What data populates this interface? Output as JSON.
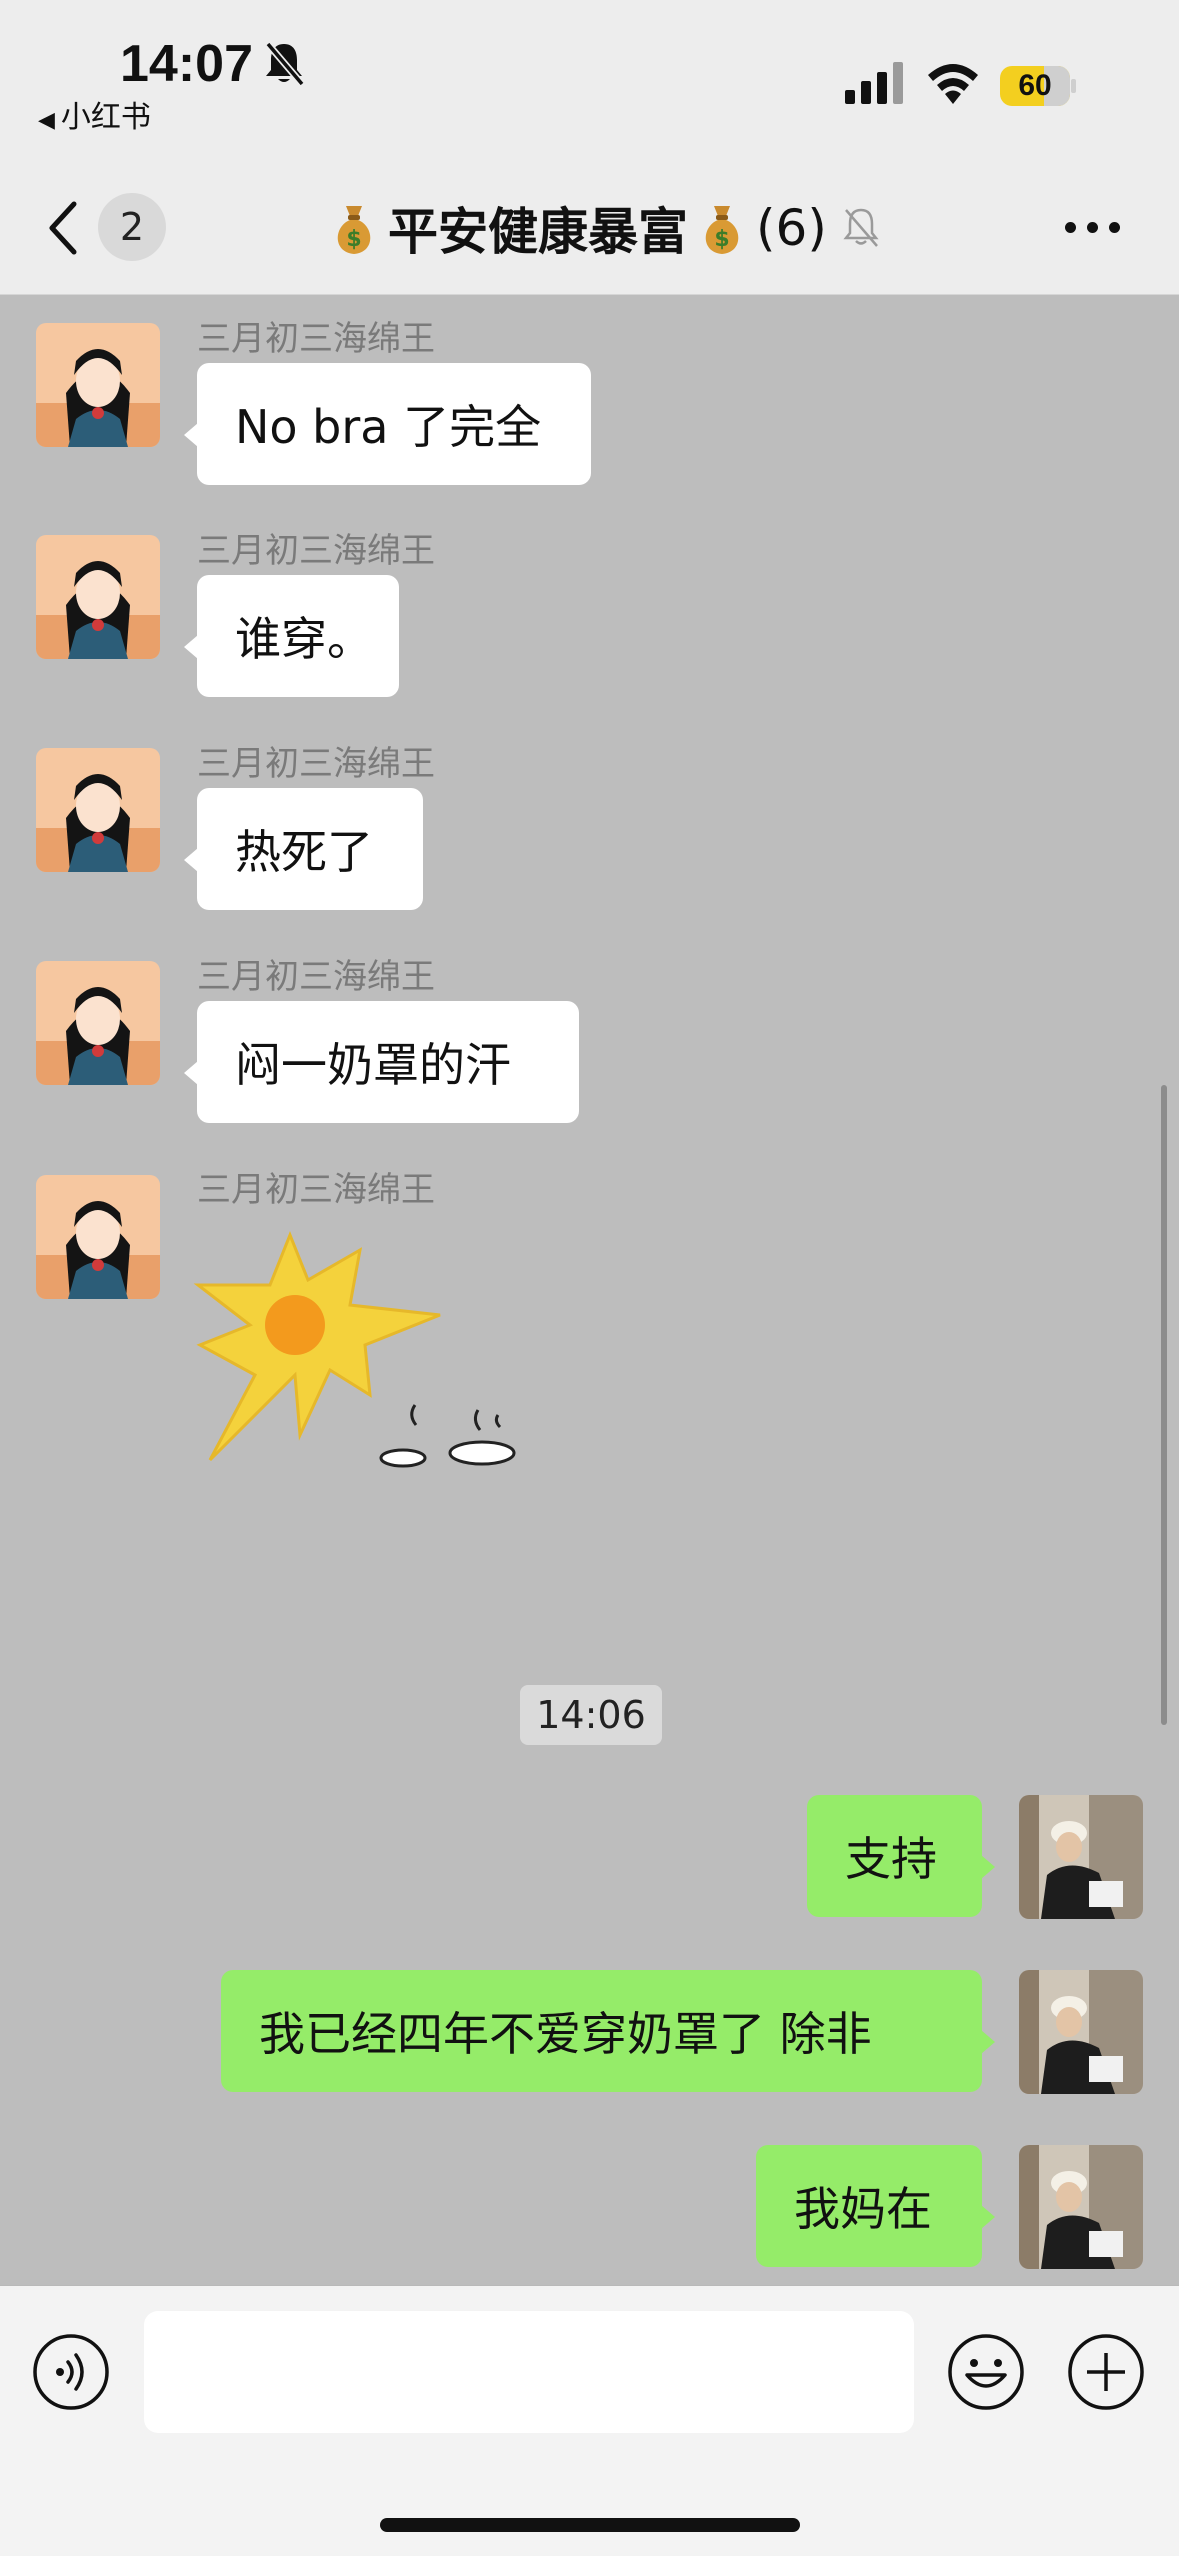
{
  "status_bar": {
    "time": "14:07",
    "back_app": "小红书",
    "battery": "60",
    "icons": [
      "bell-slash-icon",
      "signal-icon",
      "wifi-icon",
      "battery-icon"
    ],
    "battery_color": "#f3cf1f"
  },
  "nav": {
    "back_icon": "chevron-left-icon",
    "unread_badge": "2",
    "title": "平安健康暴富",
    "member_count": "(6)",
    "title_icons": [
      "money-bag-icon",
      "muted-bell-icon"
    ],
    "more_icon": "more-dots-icon"
  },
  "messages": [
    {
      "side": "left",
      "sender": "三月初三海绵王",
      "text": "No bra 了完全"
    },
    {
      "side": "left",
      "sender": "三月初三海绵王",
      "text": "谁穿。"
    },
    {
      "side": "left",
      "sender": "三月初三海绵王",
      "text": "热死了"
    },
    {
      "side": "left",
      "sender": "三月初三海绵王",
      "text": "闷一奶罩的汗"
    },
    {
      "side": "left",
      "sender": "三月初三海绵王",
      "sticker": "hot-sun-sticker"
    },
    {
      "side": "right",
      "text": "支持"
    },
    {
      "side": "right",
      "text": "我已经四年不爱穿奶罩了 除非"
    },
    {
      "side": "right",
      "text": "我妈在"
    }
  ],
  "timestamp": "14:06",
  "input_bar": {
    "voice_icon": "voice-icon",
    "emoji_icon": "emoji-icon",
    "plus_icon": "plus-icon",
    "value": ""
  },
  "colors": {
    "chat_background": "#bdbdbd",
    "outgoing_bubble": "#95ec69",
    "incoming_bubble": "#ffffff"
  }
}
